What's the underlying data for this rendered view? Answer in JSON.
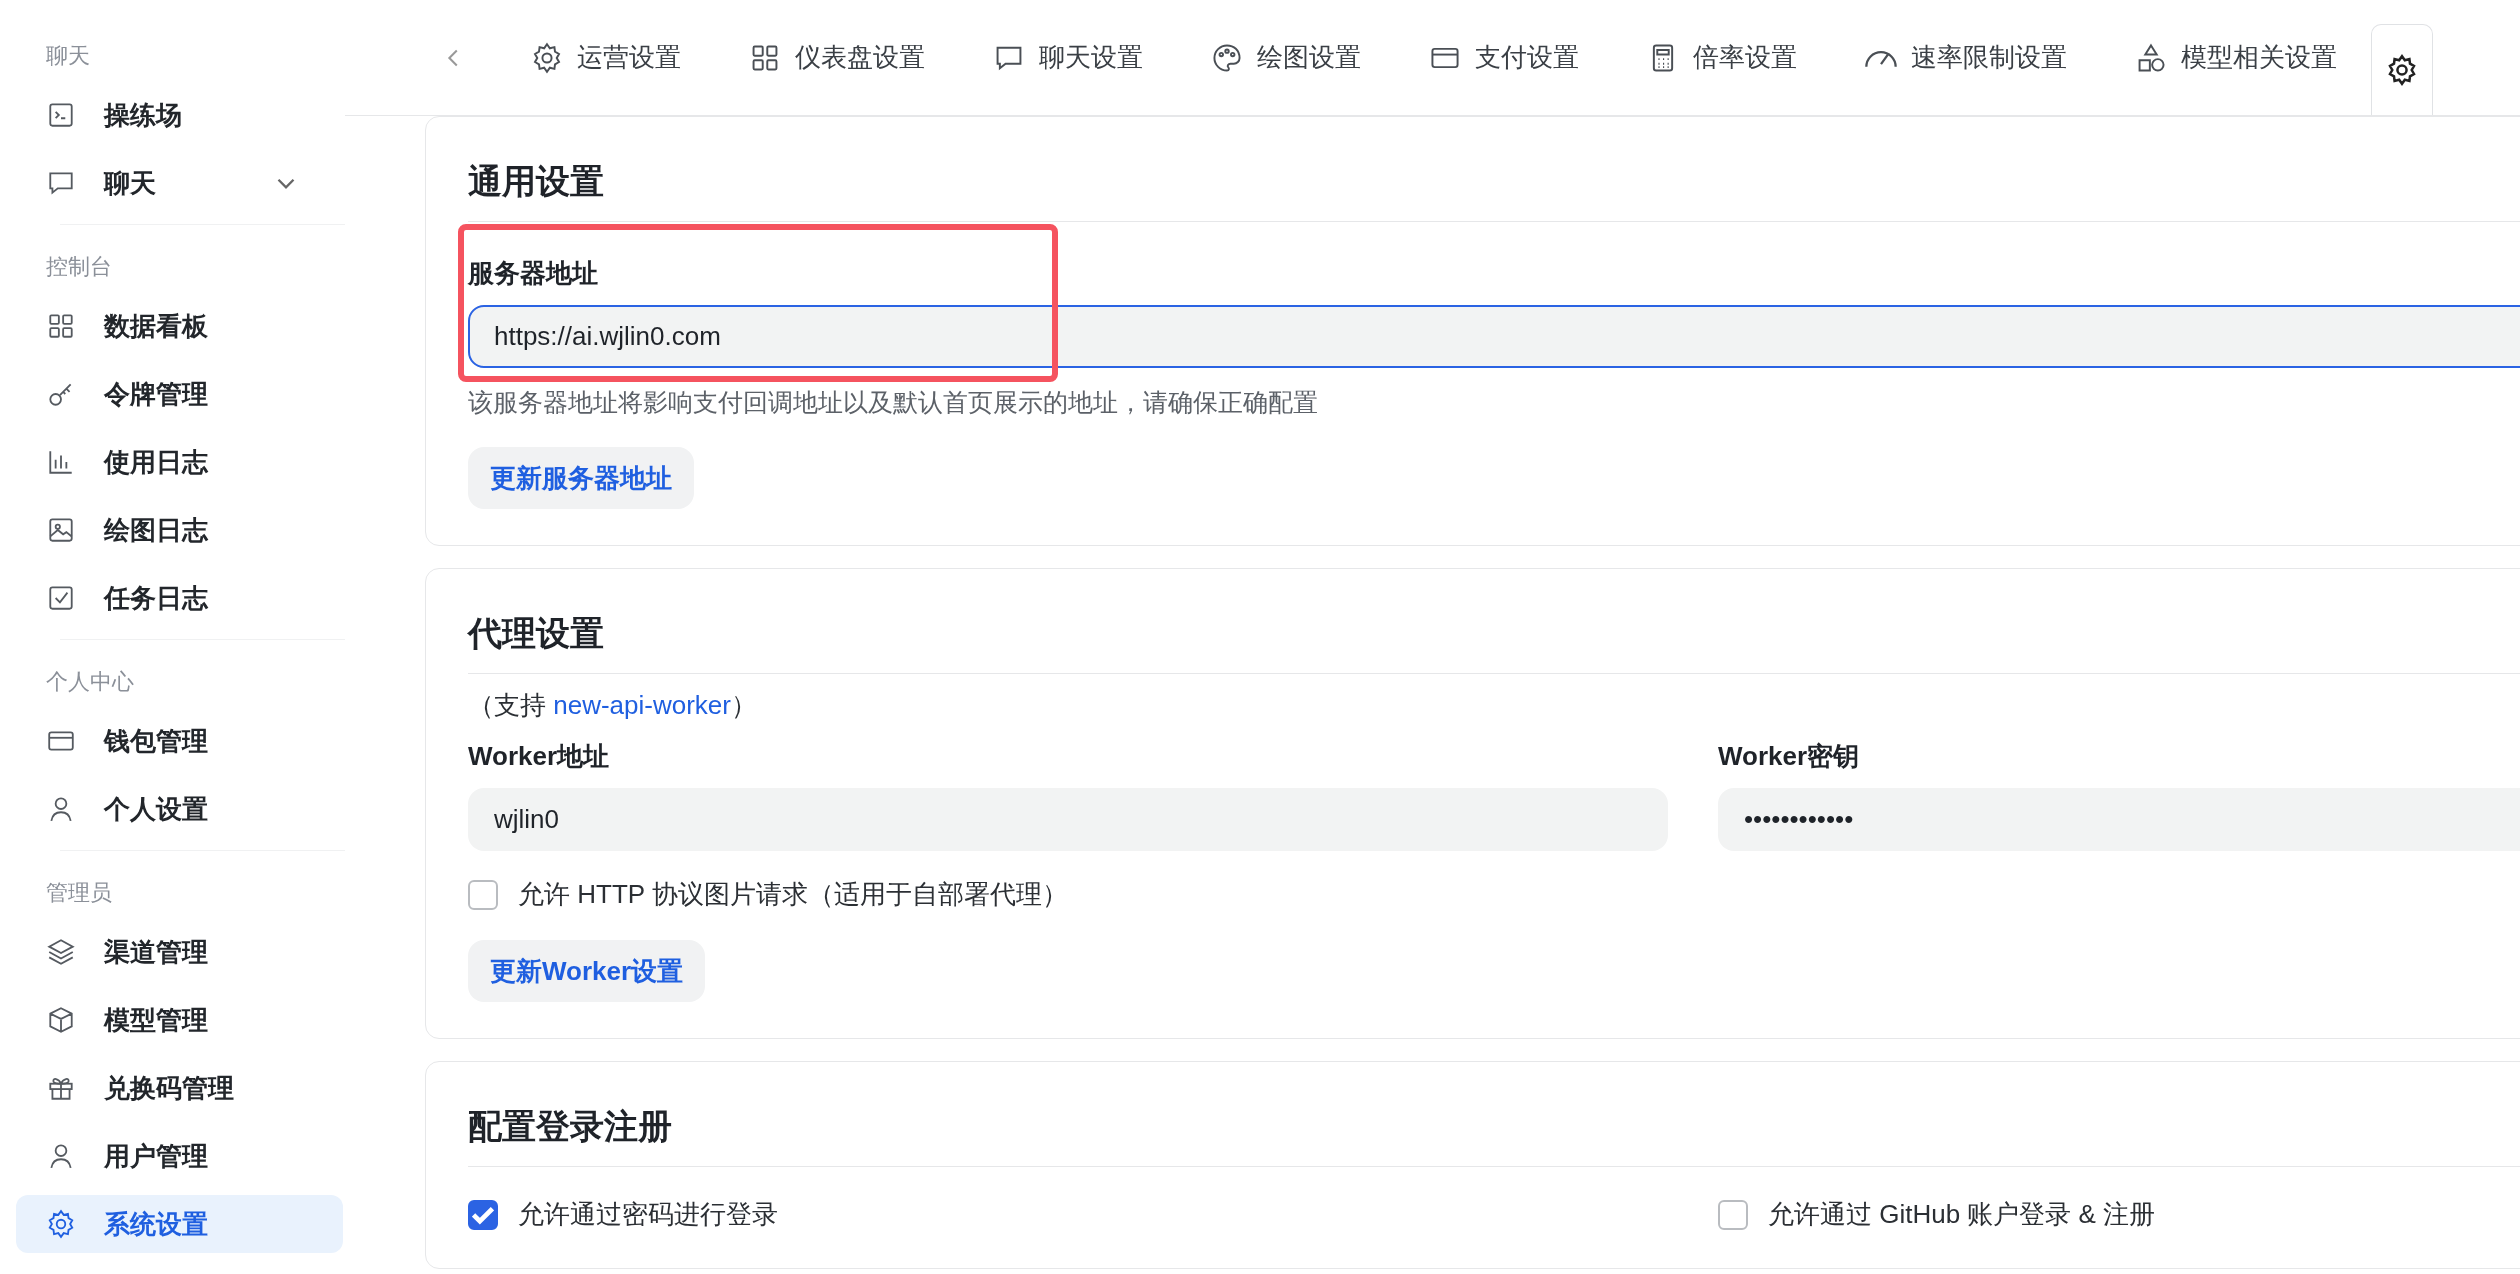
{
  "sidebar": {
    "sections": [
      {
        "header": "聊天",
        "items": [
          {
            "label": "操练场",
            "kind": "link",
            "selected": false
          },
          {
            "label": "聊天",
            "kind": "group",
            "expanded": false,
            "selected": false
          }
        ]
      },
      {
        "header": "控制台",
        "items": [
          {
            "label": "数据看板",
            "kind": "link",
            "selected": false
          },
          {
            "label": "令牌管理",
            "kind": "link",
            "selected": false
          },
          {
            "label": "使用日志",
            "kind": "link",
            "selected": false
          },
          {
            "label": "绘图日志",
            "kind": "link",
            "selected": false
          },
          {
            "label": "任务日志",
            "kind": "link",
            "selected": false
          }
        ]
      },
      {
        "header": "个人中心",
        "items": [
          {
            "label": "钱包管理",
            "kind": "link",
            "selected": false
          },
          {
            "label": "个人设置",
            "kind": "link",
            "selected": false
          }
        ]
      },
      {
        "header": "管理员",
        "items": [
          {
            "label": "渠道管理",
            "kind": "link",
            "selected": false
          },
          {
            "label": "模型管理",
            "kind": "link",
            "selected": false
          },
          {
            "label": "兑换码管理",
            "kind": "link",
            "selected": false
          },
          {
            "label": "用户管理",
            "kind": "link",
            "selected": false
          },
          {
            "label": "系统设置",
            "kind": "link",
            "selected": true
          }
        ]
      }
    ]
  },
  "tabs": [
    {
      "label": "运营设置",
      "selected": false
    },
    {
      "label": "仪表盘设置",
      "selected": false
    },
    {
      "label": "聊天设置",
      "selected": false
    },
    {
      "label": "绘图设置",
      "selected": false
    },
    {
      "label": "支付设置",
      "selected": false
    },
    {
      "label": "倍率设置",
      "selected": false
    },
    {
      "label": "速率限制设置",
      "selected": false
    },
    {
      "label": "模型相关设置",
      "selected": false
    },
    {
      "selected": true
    }
  ],
  "general": {
    "title": "通用设置",
    "field": {
      "label": "服务器地址",
      "value": "https://ai.wjlin0.com",
      "focused": true,
      "help": "该服务器地址将影响支付回调地址以及默认首页展示的地址，请确保正确配置"
    },
    "button": "更新服务器地址"
  },
  "proxy": {
    "title": "代理设置",
    "note_prefix": "（支持 ",
    "note_link": "new-api-worker",
    "note_suffix": "）",
    "fields": [
      {
        "label": "Worker地址",
        "value": "wjlin0",
        "focused": false
      },
      {
        "label": "Worker密钥",
        "value": "••••••••••••",
        "focused": false
      }
    ],
    "checkbox": {
      "label": "允许 HTTP 协议图片请求（适用于自部署代理）",
      "checked": false
    },
    "button": "更新Worker设置"
  },
  "login": {
    "title": "配置登录注册",
    "options": [
      {
        "label": "允许通过密码进行登录",
        "checked": true
      },
      {
        "label": "允许通过 GitHub 账户登录 & 注册",
        "checked": false
      }
    ]
  }
}
